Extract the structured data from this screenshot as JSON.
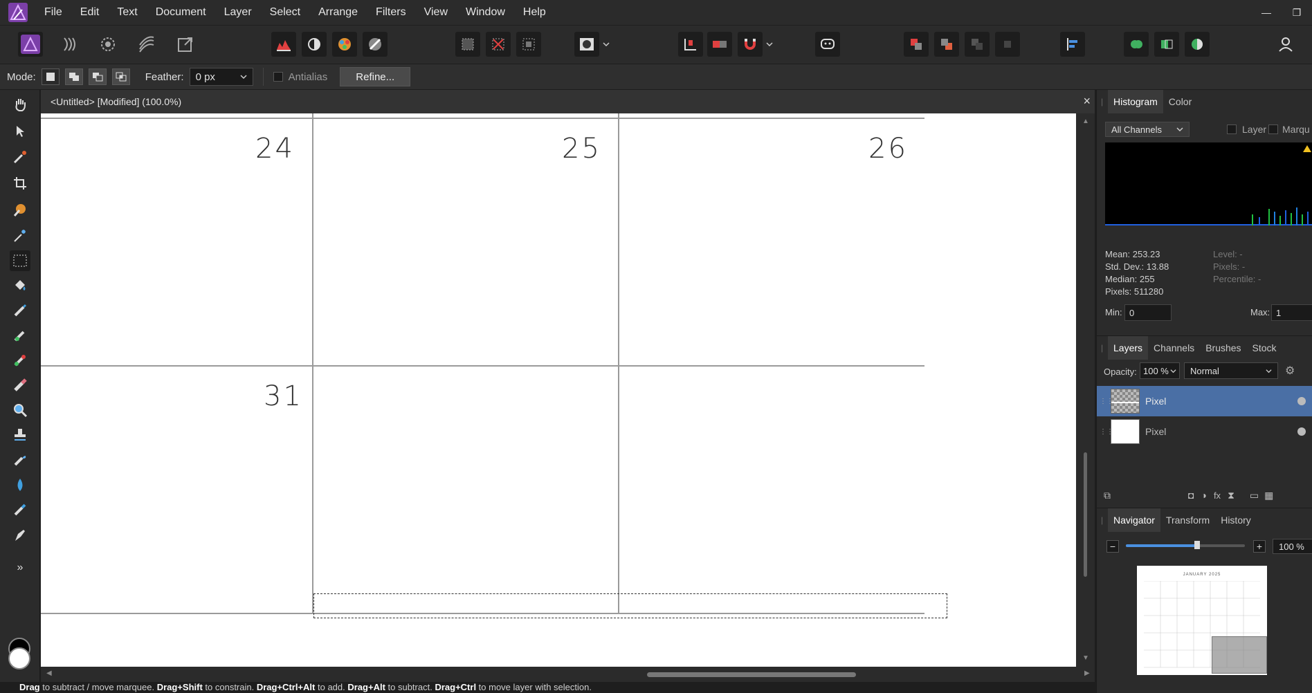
{
  "app": {
    "menu": [
      "File",
      "Edit",
      "Text",
      "Document",
      "Layer",
      "Select",
      "Arrange",
      "Filters",
      "View",
      "Window",
      "Help"
    ],
    "window_controls": [
      "—",
      "❐"
    ]
  },
  "context_bar": {
    "mode_label": "Mode:",
    "feather_label": "Feather:",
    "feather_value": "0 px",
    "antialias_label": "Antialias",
    "refine_label": "Refine..."
  },
  "document": {
    "tab_title": "<Untitled> [Modified] (100.0%)",
    "close_symbol": "×",
    "days": [
      "24",
      "25",
      "26",
      "31"
    ]
  },
  "status": {
    "parts": [
      {
        "bold": true,
        "text": "Drag"
      },
      {
        "bold": false,
        "text": " to subtract / move marquee. "
      },
      {
        "bold": true,
        "text": "Drag+Shift"
      },
      {
        "bold": false,
        "text": " to constrain. "
      },
      {
        "bold": true,
        "text": "Drag+Ctrl+Alt"
      },
      {
        "bold": false,
        "text": " to add. "
      },
      {
        "bold": true,
        "text": "Drag+Alt"
      },
      {
        "bold": false,
        "text": " to subtract. "
      },
      {
        "bold": true,
        "text": "Drag+Ctrl"
      },
      {
        "bold": false,
        "text": " to move layer with selection."
      }
    ]
  },
  "histogram": {
    "tabs": [
      "Histogram",
      "Color"
    ],
    "channel": "All Channels",
    "layer_label": "Layer",
    "marquee_label": "Marqu",
    "mean": "Mean: 253.23",
    "std_dev": "Std. Dev.: 13.88",
    "median": "Median: 255",
    "pixels": "Pixels: 511280",
    "level": "Level: -",
    "pixels_r": "Pixels: -",
    "percentile": "Percentile: -",
    "min_label": "Min:",
    "min_value": "0",
    "max_label": "Max:",
    "max_value": "1"
  },
  "layers": {
    "tabs": [
      "Layers",
      "Channels",
      "Brushes",
      "Stock"
    ],
    "opacity_label": "Opacity:",
    "opacity_value": "100 %",
    "blend_mode": "Normal",
    "items": [
      {
        "name": "Pixel",
        "selected": true
      },
      {
        "name": "Pixel",
        "selected": false
      }
    ]
  },
  "navigator": {
    "tabs": [
      "Navigator",
      "Transform",
      "History"
    ],
    "zoom": "100 %",
    "zoom_fraction": 0.6,
    "preview_title": "JANUARY 2025"
  },
  "colors": {
    "accent": "#4a6fa5",
    "panel": "#2b2b2b",
    "canvas": "#ffffff"
  }
}
